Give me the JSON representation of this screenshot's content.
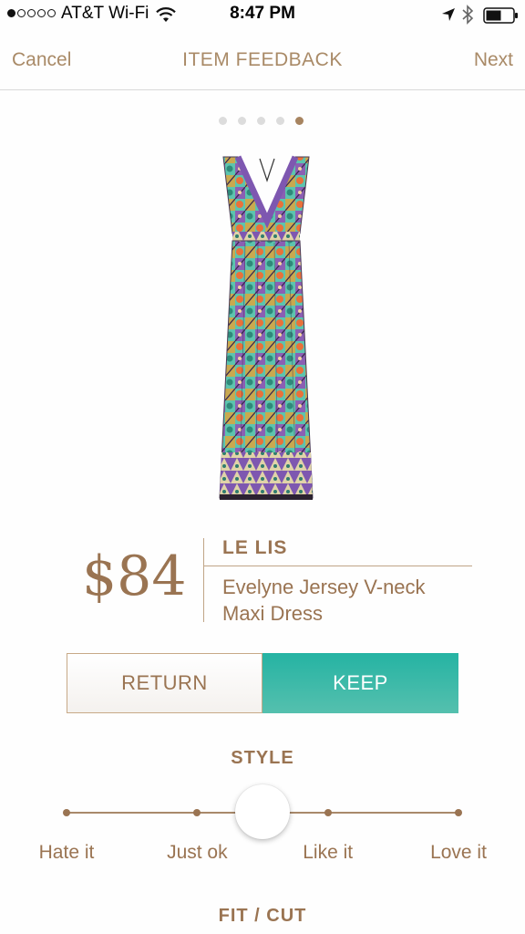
{
  "status_bar": {
    "carrier": "AT&T Wi-Fi",
    "time": "8:47 PM",
    "signal_bars_filled": 1,
    "signal_bars_total": 5
  },
  "nav": {
    "cancel_label": "Cancel",
    "title": "ITEM FEEDBACK",
    "next_label": "Next"
  },
  "pager": {
    "total": 5,
    "active_index": 4
  },
  "item": {
    "price": "$84",
    "brand": "LE LIS",
    "name": "Evelyne Jersey V-neck Maxi Dress",
    "image_icon": "dress-photo"
  },
  "actions": {
    "return_label": "RETURN",
    "keep_label": "KEEP",
    "selected": "keep"
  },
  "style": {
    "heading": "STYLE",
    "options": [
      "Hate it",
      "Just ok",
      "Like it",
      "Love it"
    ],
    "selected_position": 0.5
  },
  "fit": {
    "heading": "FIT / CUT"
  },
  "colors": {
    "accent_tan": "#9a7452",
    "keep_teal": "#2bb4a4",
    "active_dot": "#a78460"
  }
}
